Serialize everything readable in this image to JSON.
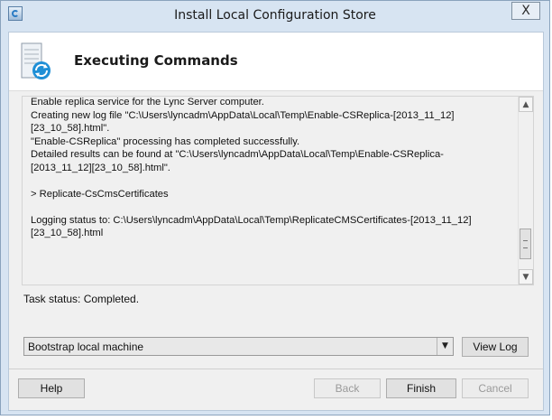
{
  "window": {
    "title": "Install Local Configuration Store",
    "close_glyph": "X",
    "icon": "setup-icon"
  },
  "header": {
    "title": "Executing Commands",
    "icon": "server-refresh-icon"
  },
  "log": {
    "lines": [
      "Enable replica service for the Lync Server computer.",
      "Creating new log file \"C:\\Users\\lyncadm\\AppData\\Local\\Temp\\Enable-CSReplica-[2013_11_12]",
      "[23_10_58].html\".",
      "\"Enable-CSReplica\" processing has completed successfully.",
      "Detailed results can be found at \"C:\\Users\\lyncadm\\AppData\\Local\\Temp\\Enable-CSReplica-",
      "[2013_11_12][23_10_58].html\".",
      "",
      "> Replicate-CsCmsCertificates",
      "",
      "Logging status to: C:\\Users\\lyncadm\\AppData\\Local\\Temp\\ReplicateCMSCertificates-[2013_11_12]",
      "[23_10_58].html"
    ]
  },
  "task_status": "Task status: Completed.",
  "action_select": {
    "selected": "Bootstrap local machine"
  },
  "buttons": {
    "view_log": "View Log",
    "help": "Help",
    "back": "Back",
    "finish": "Finish",
    "cancel": "Cancel"
  }
}
